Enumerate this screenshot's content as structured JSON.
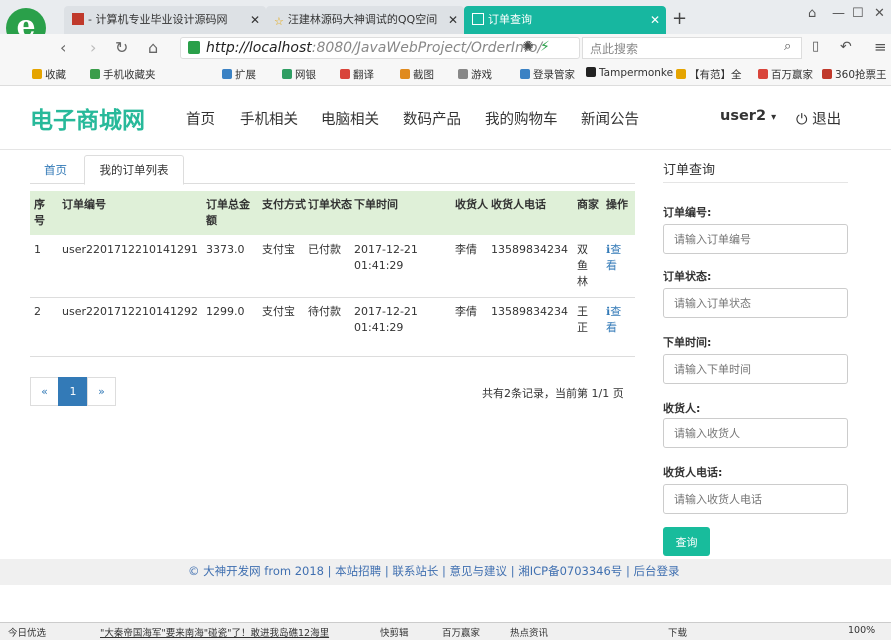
{
  "browser": {
    "tabs": [
      {
        "label": "- 计算机专业毕业设计源码网"
      },
      {
        "label": "汪建林源码大神调试的QQ空间"
      },
      {
        "label": "订单查询"
      }
    ],
    "url_host": "http://localhost",
    "url_path": ":8080/JavaWebProject/OrderInfo/",
    "search_placeholder": "点此搜索",
    "bookmarks": [
      {
        "label": "收藏",
        "color": "#e5a400"
      },
      {
        "label": "手机收藏夹",
        "color": "#3a9d4a"
      },
      {
        "label": "扩展",
        "color": "#3b82c4"
      },
      {
        "label": "网银",
        "color": "#2f9e63"
      },
      {
        "label": "翻译",
        "color": "#d9443a"
      },
      {
        "label": "截图",
        "color": "#e08a1e"
      },
      {
        "label": "游戏",
        "color": "#888888"
      },
      {
        "label": "登录管家",
        "color": "#3b82c4"
      },
      {
        "label": "Tampermonke",
        "color": "#222222"
      },
      {
        "label": "【有范】全",
        "color": "#e5a400"
      },
      {
        "label": "百万赢家",
        "color": "#d9443a"
      },
      {
        "label": "360抢票王",
        "color": "#c0392b"
      }
    ]
  },
  "site": {
    "brand": "电子商城网",
    "menu": [
      "首页",
      "手机相关",
      "电脑相关",
      "数码产品",
      "我的购物车",
      "新闻公告"
    ],
    "user": "user2",
    "logout": "退出"
  },
  "breadcrumb": {
    "home": "首页",
    "current": "我的订单列表"
  },
  "table": {
    "headers": [
      "序号",
      "订单编号",
      "订单总金额",
      "支付方式",
      "订单状态",
      "下单时间",
      "收货人",
      "收货人电话",
      "商家",
      "操作"
    ],
    "rows": [
      {
        "no": "1",
        "order_no": "user2201712210141291",
        "amount": "3373.0",
        "pay": "支付宝",
        "status": "已付款",
        "time": "2017-12-21 01:41:29",
        "receiver": "李倩",
        "phone": "13589834234",
        "merchant": "双鱼林",
        "action": "查看"
      },
      {
        "no": "2",
        "order_no": "user2201712210141292",
        "amount": "1299.0",
        "pay": "支付宝",
        "status": "待付款",
        "time": "2017-12-21 01:41:29",
        "receiver": "李倩",
        "phone": "13589834234",
        "merchant": "王正",
        "action": "查看"
      }
    ]
  },
  "pager": {
    "prev": "«",
    "current": "1",
    "next": "»",
    "summary": "共有2条记录，当前第 1/1 页"
  },
  "sidebar": {
    "title": "订单查询",
    "fields": [
      {
        "label": "订单编号:",
        "placeholder": "请输入订单编号"
      },
      {
        "label": "订单状态:",
        "placeholder": "请输入订单状态"
      },
      {
        "label": "下单时间:",
        "placeholder": "请输入下单时间"
      },
      {
        "label": "收货人:",
        "placeholder": "请输入收货人"
      },
      {
        "label": "收货人电话:",
        "placeholder": "请输入收货人电话"
      }
    ],
    "button": "查询"
  },
  "footer": "© 大神开发网 from 2018 | 本站招聘 | 联系站长 | 意见与建议 | 湘ICP备0703346号 | 后台登录",
  "statusbar": [
    "今日优选",
    "\"大秦帝国海军\"要来南海\"碰瓷\"了！敢进我岛礁12海里",
    "快剪辑",
    "百万赢家",
    "热点资讯",
    "下载",
    "100%"
  ],
  "colors": {
    "accent": "#27b99a",
    "tab_active": "#17b7a0",
    "button": "#18bc9c",
    "link": "#337ab7",
    "thead": "#dff0d8"
  }
}
